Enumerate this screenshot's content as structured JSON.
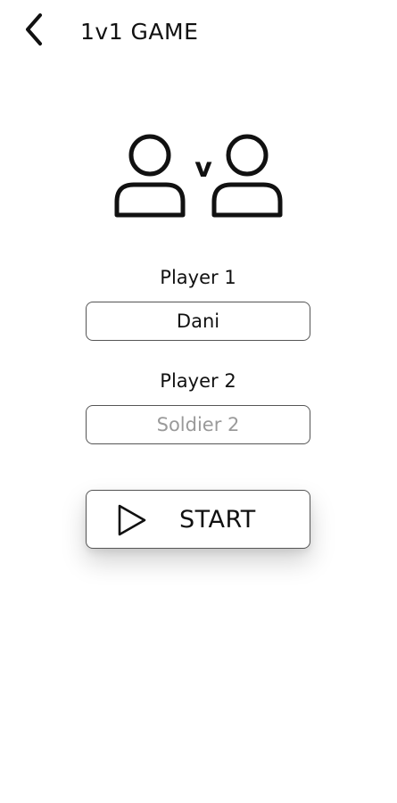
{
  "header": {
    "back_icon": "chevron-left-icon",
    "title": "1v1 GAME"
  },
  "illustration": {
    "icon": "players-versus-icon",
    "versus_letter": "v"
  },
  "player1": {
    "label": "Player 1",
    "value": "Dani"
  },
  "player2": {
    "label": "Player 2",
    "value": "",
    "placeholder": "Soldier 2"
  },
  "start_button": {
    "icon": "play-icon",
    "label": "START"
  }
}
